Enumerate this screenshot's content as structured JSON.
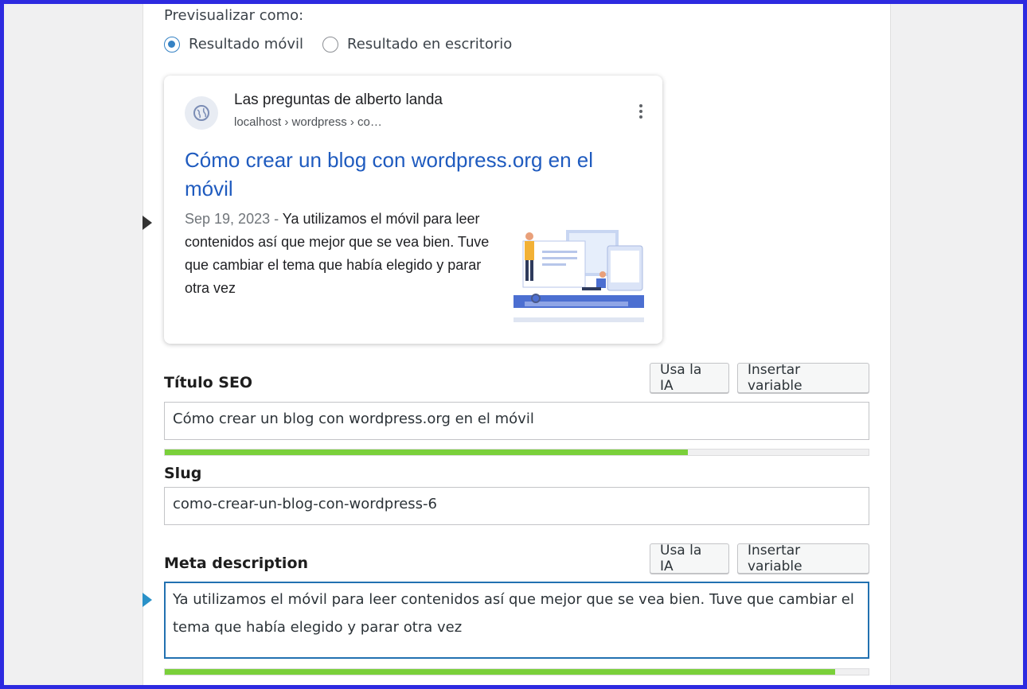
{
  "preview": {
    "label": "Previsualizar como:",
    "options": [
      {
        "label": "Resultado móvil",
        "selected": true
      },
      {
        "label": "Resultado en escritorio",
        "selected": false
      }
    ]
  },
  "serp": {
    "site_name": "Las preguntas de alberto landa",
    "url": "localhost › wordpress › co…",
    "title": "Cómo crear un blog con wordpress.org en el móvil",
    "date": "Sep 19, 2023",
    "separator": " - ",
    "description": "Ya utilizamos el móvil para leer contenidos así que mejor que se vea bien. Tuve que cambiar el tema que había elegido y parar otra vez",
    "favicon_icon": "globe-icon",
    "menu_icon": "more-vertical-icon"
  },
  "seo_title": {
    "label": "Título SEO",
    "ai_button": "Usa la IA",
    "variable_button": "Insertar variable",
    "value": "Cómo crear un blog con wordpress.org en el móvil",
    "progress": 0.743
  },
  "slug": {
    "label": "Slug",
    "value": "como-crear-un-blog-con-wordpress-6"
  },
  "meta_description": {
    "label": "Meta description",
    "ai_button": "Usa la IA",
    "variable_button": "Insertar variable",
    "value": "Ya utilizamos el móvil para leer contenidos así que mejor que se vea bien. Tuve que cambiar el tema que había elegido y parar otra vez",
    "progress": 0.953
  },
  "colors": {
    "frame": "#2d2ae0",
    "link_blue": "#1f5bbf",
    "progress_green": "#7ad03a",
    "radio_blue": "#3582c4"
  }
}
